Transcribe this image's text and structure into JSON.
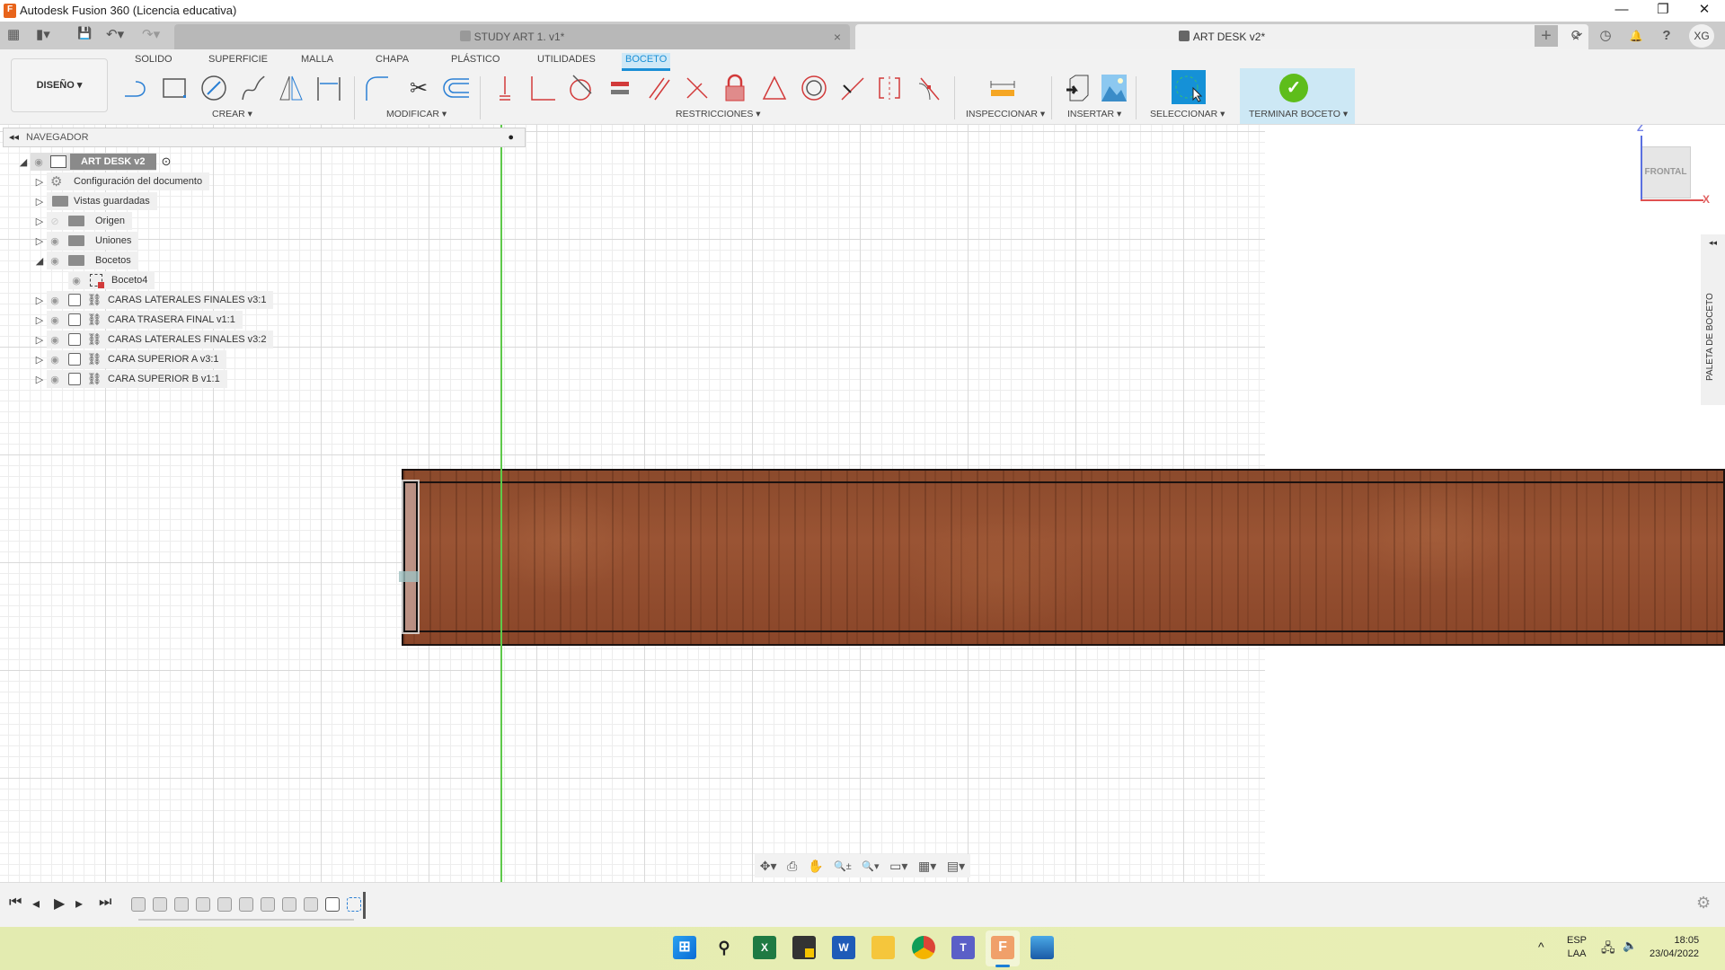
{
  "window": {
    "title": "Autodesk Fusion 360 (Licencia educativa)",
    "controls": {
      "minimize": "—",
      "maximize": "❐",
      "close": "✕"
    }
  },
  "tabs": [
    {
      "label": "STUDY ART 1. v1*",
      "active": false
    },
    {
      "label": "ART DESK v2*",
      "active": true
    }
  ],
  "quick_access": {
    "grid": "▦",
    "file": "▮▾",
    "save": "💾",
    "undo": "↶▾",
    "redo": "↷▾"
  },
  "top_right_icons": {
    "new_tab": "+",
    "extensions": "⟳",
    "job_status": "◷",
    "notifications": "🔔",
    "help": "?",
    "avatar": "XG"
  },
  "ribbon": {
    "workspace": "DISEÑO ▾",
    "tabs": [
      "SOLIDO",
      "SUPERFICIE",
      "MALLA",
      "CHAPA",
      "PLÁSTICO",
      "UTILIDADES",
      "BOCETO"
    ],
    "active_tab": "BOCETO",
    "groups": {
      "crear": "CREAR ▾",
      "modificar": "MODIFICAR ▾",
      "restricciones": "RESTRICCIONES ▾",
      "inspeccionar": "INSPECCIONAR ▾",
      "insertar": "INSERTAR ▾",
      "seleccionar": "SELECCIONAR ▾",
      "terminar": "TERMINAR BOCETO ▾"
    },
    "colors": {
      "accent": "#1a8fd6",
      "constraint": "#d23a3a",
      "finish": "#5ebd1b"
    }
  },
  "browser": {
    "title": "NAVEGADOR",
    "root": "ART DESK v2",
    "items": [
      {
        "label": "Configuración del documento",
        "expanded": false
      },
      {
        "label": "Vistas guardadas",
        "expanded": false
      },
      {
        "label": "Origen",
        "expanded": false,
        "hidden": true
      },
      {
        "label": "Uniones",
        "expanded": false
      },
      {
        "label": "Bocetos",
        "expanded": true
      },
      {
        "label": "Boceto4",
        "child": true
      },
      {
        "label": "CARAS LATERALES FINALES v3:1"
      },
      {
        "label": "CARA TRASERA  FINAL v1:1"
      },
      {
        "label": "CARAS LATERALES FINALES v3:2"
      },
      {
        "label": "CARA SUPERIOR A v3:1"
      },
      {
        "label": "CARA SUPERIOR B v1:1"
      }
    ]
  },
  "viewcube": {
    "face": "FRONTAL",
    "z": "Z",
    "x": "X"
  },
  "palette": {
    "label": "PALETA DE BOCETO",
    "collapse": "◂◂"
  },
  "navbar": [
    "✥▾",
    "⎙",
    "✋",
    "🔍±",
    "🔍▾",
    "▭▾",
    "▦▾",
    "▤▾"
  ],
  "timeline": {
    "controls": [
      "⏮",
      "◂",
      "▶",
      "▸",
      "⏭"
    ],
    "features": 11,
    "settings": "⚙"
  },
  "taskbar": {
    "apps": [
      "Inicio",
      "Buscar",
      "Excel",
      "Notas",
      "Word",
      "Explorador",
      "Chrome",
      "Teams",
      "Fusion 360",
      "Fotos"
    ],
    "language": [
      "ESP",
      "LAA"
    ],
    "time": "18:05",
    "date": "23/04/2022"
  }
}
